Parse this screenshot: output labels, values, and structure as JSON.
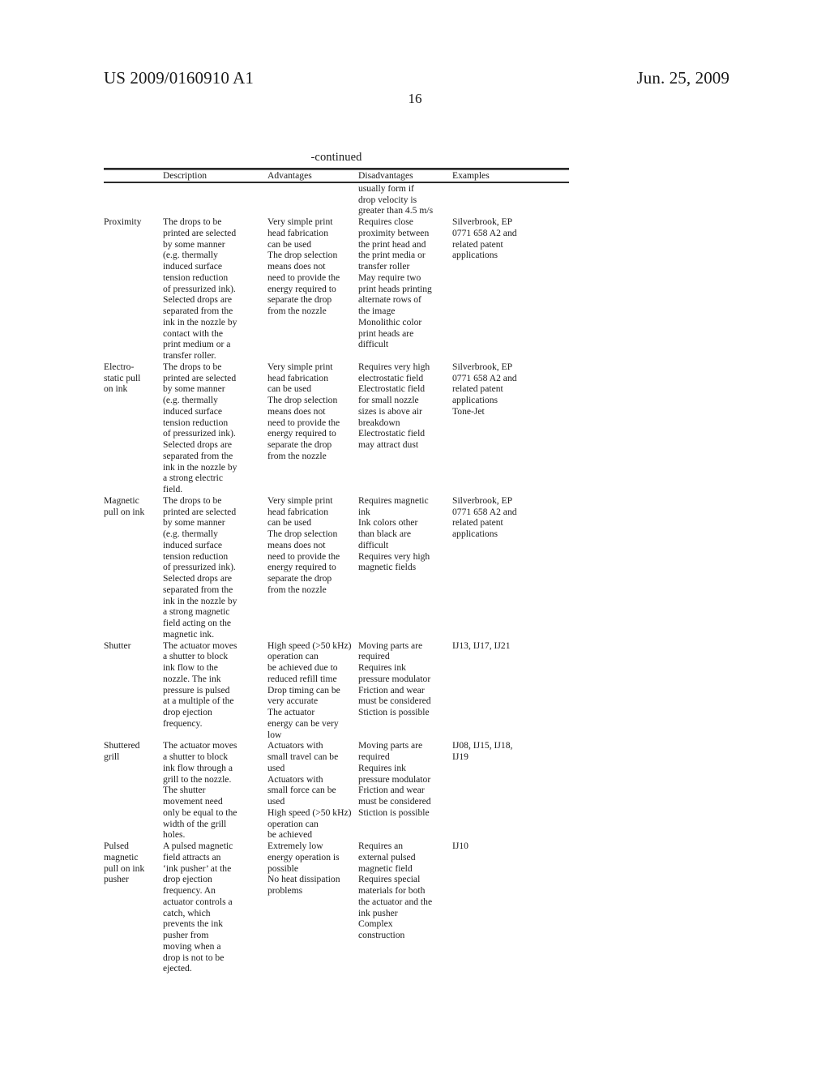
{
  "header": {
    "publication_number": "US 2009/0160910 A1",
    "publication_date": "Jun. 25, 2009",
    "page_number": "16"
  },
  "table": {
    "caption": "-continued",
    "columns": [
      {
        "key": "label",
        "label": ""
      },
      {
        "key": "description",
        "label": "Description"
      },
      {
        "key": "advantages",
        "label": "Advantages"
      },
      {
        "key": "disadvantages",
        "label": "Disadvantages"
      },
      {
        "key": "examples",
        "label": "Examples"
      }
    ],
    "orphan_lines": {
      "disadvantages": "usually form if\ndrop velocity is\ngreater than 4.5 m/s"
    },
    "rows": [
      {
        "label": "Proximity",
        "description": "The drops to be\nprinted are selected\nby some manner\n(e.g. thermally\ninduced surface\ntension reduction\nof pressurized ink).\nSelected drops are\nseparated from the\nink in the nozzle by\ncontact with the\nprint medium or a\ntransfer roller.",
        "advantages": "Very simple print\nhead fabrication\ncan be used\nThe drop selection\nmeans does not\nneed to provide the\nenergy required to\nseparate the drop\nfrom the nozzle",
        "disadvantages": "Requires close\nproximity between\nthe print head and\nthe print media or\ntransfer roller\nMay require two\nprint heads printing\nalternate rows of\nthe image\nMonolithic color\nprint heads are\ndifficult",
        "examples": "Silverbrook, EP\n0771 658 A2 and\nrelated patent\napplications"
      },
      {
        "label": "Electro-\nstatic pull\non ink",
        "description": "The drops to be\nprinted are selected\nby some manner\n(e.g. thermally\ninduced surface\ntension reduction\nof pressurized ink).\nSelected drops are\nseparated from the\nink in the nozzle by\na strong electric\nfield.",
        "advantages": "Very simple print\nhead fabrication\ncan be used\nThe drop selection\nmeans does not\nneed to provide the\nenergy required to\nseparate the drop\nfrom the nozzle",
        "disadvantages": "Requires very high\nelectrostatic field\nElectrostatic field\nfor small nozzle\nsizes is above air\nbreakdown\nElectrostatic field\nmay attract dust",
        "examples": "Silverbrook, EP\n0771 658 A2 and\nrelated patent\napplications\nTone-Jet"
      },
      {
        "label": "Magnetic\npull on ink",
        "description": "The drops to be\nprinted are selected\nby some manner\n(e.g. thermally\ninduced surface\ntension reduction\nof pressurized ink).\nSelected drops are\nseparated from the\nink in the nozzle by\na strong magnetic\nfield acting on the\nmagnetic ink.",
        "advantages": "Very simple print\nhead fabrication\ncan be used\nThe drop selection\nmeans does not\nneed to provide the\nenergy required to\nseparate the drop\nfrom the nozzle",
        "disadvantages": "Requires magnetic\nink\nInk colors other\nthan black are\ndifficult\nRequires very high\nmagnetic fields",
        "examples": "Silverbrook, EP\n0771 658 A2 and\nrelated patent\napplications"
      },
      {
        "label": "Shutter",
        "description": "The actuator moves\na shutter to block\nink flow to the\nnozzle. The ink\npressure is pulsed\nat a multiple of the\ndrop ejection\nfrequency.",
        "advantages": "High speed (>50 kHz)\noperation can\nbe achieved due to\nreduced refill time\nDrop timing can be\nvery accurate\nThe actuator\nenergy can be very\nlow",
        "disadvantages": "Moving parts are\nrequired\nRequires ink\npressure modulator\nFriction and wear\nmust be considered\nStiction is possible",
        "examples": "IJ13, IJ17, IJ21"
      },
      {
        "label": "Shuttered\ngrill",
        "description": "The actuator moves\na shutter to block\nink flow through a\ngrill to the nozzle.\nThe shutter\nmovement need\nonly be equal to the\nwidth of the grill\nholes.",
        "advantages": "Actuators with\nsmall travel can be\nused\nActuators with\nsmall force can be\nused\nHigh speed (>50 kHz)\noperation can\nbe achieved",
        "disadvantages": "Moving parts are\nrequired\nRequires ink\npressure modulator\nFriction and wear\nmust be considered\nStiction is possible",
        "examples": "IJ08, IJ15, IJ18,\nIJ19"
      },
      {
        "label": "Pulsed\nmagnetic\npull on ink\npusher",
        "description": "A pulsed magnetic\nfield attracts an\n‘ink pusher’ at the\ndrop ejection\nfrequency. An\nactuator controls a\ncatch, which\nprevents the ink\npusher from\nmoving when a\ndrop is not to be\nejected.",
        "advantages": "Extremely low\nenergy operation is\npossible\nNo heat dissipation\nproblems",
        "disadvantages": "Requires an\nexternal pulsed\nmagnetic field\nRequires special\nmaterials for both\nthe actuator and the\nink pusher\nComplex\nconstruction",
        "examples": "IJ10"
      }
    ]
  }
}
